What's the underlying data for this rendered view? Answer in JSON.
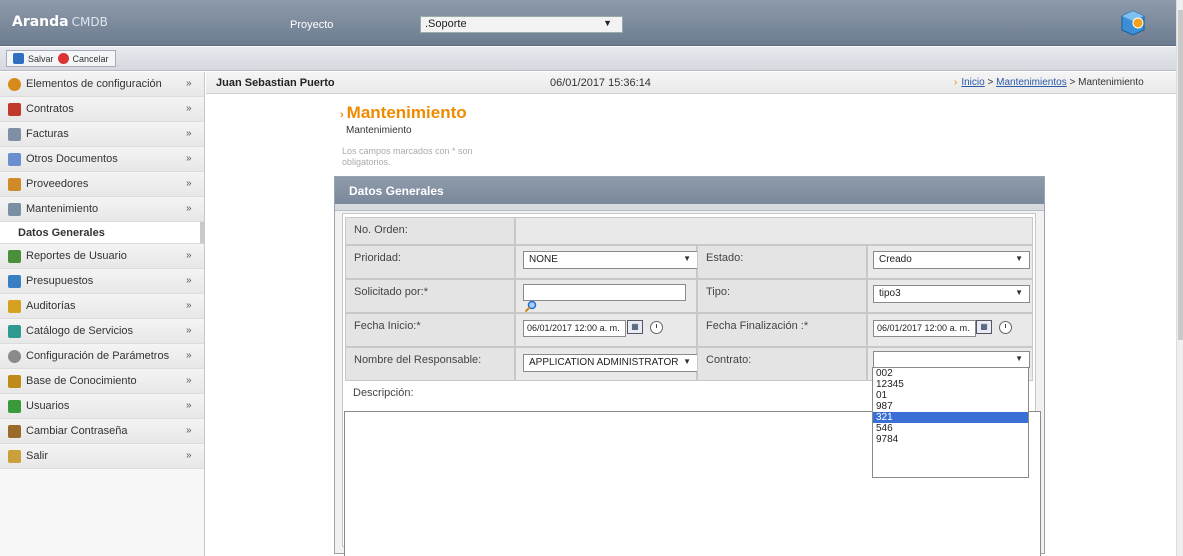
{
  "app": {
    "name": "Aranda",
    "product": "CMDB"
  },
  "project": {
    "label": "Proyecto",
    "value": ".Soporte"
  },
  "toolbar": {
    "save_label": "Salvar",
    "cancel_label": "Cancelar"
  },
  "sidebar": {
    "items": [
      {
        "label": "Elementos de configuración",
        "icon": "config-items-icon",
        "color": "#d88a1a"
      },
      {
        "label": "Contratos",
        "icon": "pen-icon",
        "color": "#c0392b"
      },
      {
        "label": "Facturas",
        "icon": "invoice-icon",
        "color": "#7f8fa6"
      },
      {
        "label": "Otros Documentos",
        "icon": "documents-icon",
        "color": "#6a8fd0"
      },
      {
        "label": "Proveedores",
        "icon": "providers-icon",
        "color": "#d08a2a"
      },
      {
        "label": "Mantenimiento",
        "icon": "maintenance-icon",
        "color": "#7b8fa3"
      },
      {
        "label": "Reportes de Usuario",
        "icon": "reports-icon",
        "color": "#4a8f3a"
      },
      {
        "label": "Presupuestos",
        "icon": "budget-icon",
        "color": "#3a7fc4"
      },
      {
        "label": "Auditorías",
        "icon": "audit-icon",
        "color": "#d6a020"
      },
      {
        "label": "Catálogo de Servicios",
        "icon": "services-icon",
        "color": "#2e9a8f"
      },
      {
        "label": "Configuración de Parámetros",
        "icon": "parameters-icon",
        "color": "#8a8a8a"
      },
      {
        "label": "Base de Conocimiento",
        "icon": "knowledge-icon",
        "color": "#c08a1a"
      },
      {
        "label": "Usuarios",
        "icon": "users-icon",
        "color": "#3a9a3a"
      },
      {
        "label": "Cambiar Contraseña",
        "icon": "password-icon",
        "color": "#9a6a2a"
      },
      {
        "label": "Salir",
        "icon": "exit-icon",
        "color": "#c9a03a"
      }
    ],
    "active_sub": "Datos Generales"
  },
  "header": {
    "user": "Juan Sebastian Puerto",
    "datetime": "06/01/2017 15:36:14",
    "breadcrumb": [
      "Inicio",
      "Mantenimientos",
      "Mantenimiento"
    ]
  },
  "page": {
    "title": "Mantenimiento",
    "subtitle": "Mantenimiento",
    "required_note": "Los campos marcados con * son obligatorios."
  },
  "form": {
    "panel_title": "Datos Generales",
    "orden_label": "No. Orden:",
    "prioridad_label": "Prioridad:",
    "prioridad_value": "NONE",
    "estado_label": "Estado:",
    "estado_value": "Creado",
    "solicitado_label": "Solicitado por:*",
    "solicitado_value": "",
    "tipo_label": "Tipo:",
    "tipo_value": "tipo3",
    "fecha_inicio_label": "Fecha Inicio:*",
    "fecha_inicio_value": "06/01/2017 12:00 a. m.",
    "fecha_fin_label": "Fecha Finalización :*",
    "fecha_fin_value": "06/01/2017 12:00 a. m.",
    "responsable_label": "Nombre del Responsable:",
    "responsable_value": "APPLICATION ADMINISTRATOR",
    "contrato_label": "Contrato:",
    "contrato_value": "",
    "descripcion_label": "Descripción:",
    "contrato_options": [
      "002",
      "12345",
      "01",
      "987",
      "321",
      "546",
      "9784"
    ],
    "contrato_highlighted": "321"
  }
}
